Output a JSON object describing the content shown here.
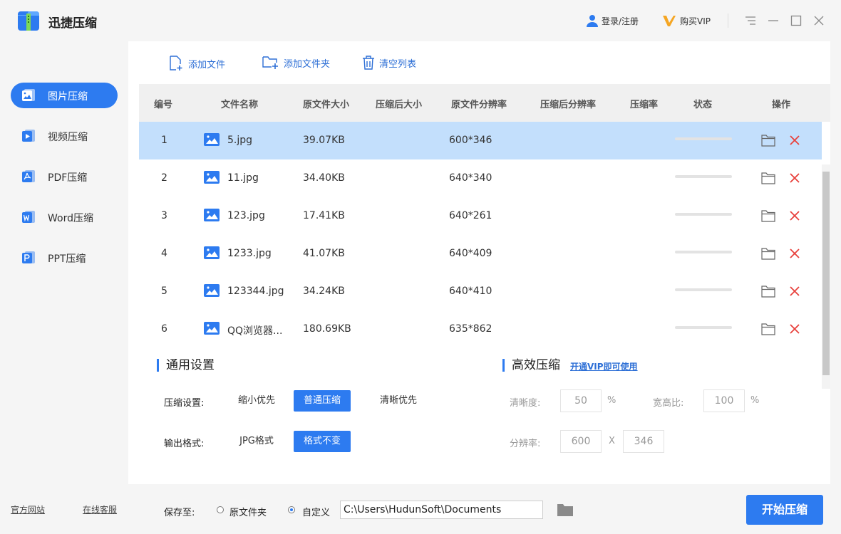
{
  "app": {
    "title": "迅捷压缩"
  },
  "titlebar": {
    "login_label": "登录/注册",
    "vip_label": "购买VIP"
  },
  "sidebar": {
    "items": [
      {
        "label": "图片压缩",
        "icon": "image-compress-icon"
      },
      {
        "label": "视频压缩",
        "icon": "video-compress-icon"
      },
      {
        "label": "PDF压缩",
        "icon": "pdf-compress-icon"
      },
      {
        "label": "Word压缩",
        "icon": "word-compress-icon"
      },
      {
        "label": "PPT压缩",
        "icon": "ppt-compress-icon"
      }
    ],
    "active": 0,
    "footer_links": [
      "官方网站",
      "在线客服"
    ]
  },
  "toolbar": {
    "add_file": "添加文件",
    "add_folder": "添加文件夹",
    "clear_list": "清空列表"
  },
  "table": {
    "columns": [
      "编号",
      "文件名称",
      "原文件大小",
      "压缩后大小",
      "原文件分辨率",
      "压缩后分辨率",
      "压缩率",
      "状态",
      "操作"
    ],
    "rows": [
      {
        "id": "1",
        "name": "5.jpg",
        "size": "39.07KB",
        "compressed_size": "",
        "resolution": "600*346",
        "compressed_resolution": "",
        "ratio": "",
        "progress": 0,
        "selected": true
      },
      {
        "id": "2",
        "name": "11.jpg",
        "size": "34.40KB",
        "compressed_size": "",
        "resolution": "640*340",
        "compressed_resolution": "",
        "ratio": "",
        "progress": 0,
        "selected": false
      },
      {
        "id": "3",
        "name": "123.jpg",
        "size": "17.41KB",
        "compressed_size": "",
        "resolution": "640*261",
        "compressed_resolution": "",
        "ratio": "",
        "progress": 0,
        "selected": false
      },
      {
        "id": "4",
        "name": "1233.jpg",
        "size": "41.07KB",
        "compressed_size": "",
        "resolution": "640*409",
        "compressed_resolution": "",
        "ratio": "",
        "progress": 0,
        "selected": false
      },
      {
        "id": "5",
        "name": "123344.jpg",
        "size": "34.24KB",
        "compressed_size": "",
        "resolution": "640*410",
        "compressed_resolution": "",
        "ratio": "",
        "progress": 0,
        "selected": false
      },
      {
        "id": "6",
        "name": "QQ浏览器...",
        "size": "180.69KB",
        "compressed_size": "",
        "resolution": "635*862",
        "compressed_resolution": "",
        "ratio": "",
        "progress": 0,
        "selected": false
      }
    ]
  },
  "general_settings": {
    "title": "通用设置",
    "compress_label": "压缩设置:",
    "compress_options": [
      "缩小优先",
      "普通压缩",
      "清晰优先"
    ],
    "compress_selected": 1,
    "format_label": "输出格式:",
    "format_options": [
      "JPG格式",
      "格式不变"
    ],
    "format_selected": 1
  },
  "advanced_settings": {
    "title": "高效压缩",
    "vip_link": "开通VIP即可使用",
    "clarity_label": "清晰度:",
    "clarity_value": "50",
    "clarity_unit": "%",
    "aspect_label": "宽高比:",
    "aspect_value": "100",
    "aspect_unit": "%",
    "resolution_label": "分辨率:",
    "width_value": "600",
    "separator": "X",
    "height_value": "346"
  },
  "footer": {
    "save_to_label": "保存至:",
    "option_original": "原文件夹",
    "option_custom": "自定义",
    "selected": "custom",
    "path": "C:\\Users\\HudunSoft\\Documents",
    "start_button": "开始压缩"
  },
  "colors": {
    "accent": "#2d7bf0",
    "selected_row": "#c3dffc",
    "delete": "#e8413c"
  }
}
